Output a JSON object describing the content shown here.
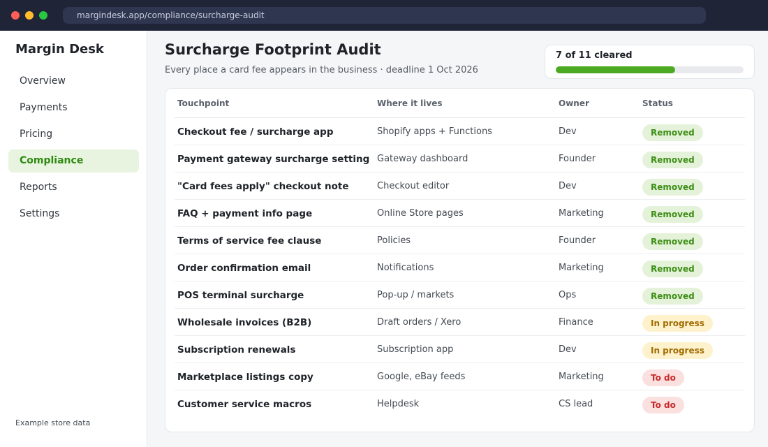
{
  "window": {
    "url": "margindesk.app/compliance/surcharge-audit"
  },
  "sidebar": {
    "brand": "Margin Desk",
    "items": [
      {
        "label": "Overview"
      },
      {
        "label": "Payments"
      },
      {
        "label": "Pricing"
      },
      {
        "label": "Compliance",
        "active": true
      },
      {
        "label": "Reports"
      },
      {
        "label": "Settings"
      }
    ],
    "footnote": "Example store data"
  },
  "header": {
    "title": "Surcharge Footprint Audit",
    "subtitle": "Every place a card fee appears in the business · deadline 1 Oct 2026"
  },
  "progress": {
    "label": "7 of 11 cleared",
    "cleared": 7,
    "total": 11
  },
  "table": {
    "columns": [
      "Touchpoint",
      "Where it lives",
      "Owner",
      "Status"
    ],
    "rows": [
      {
        "touchpoint": "Checkout fee / surcharge app",
        "location": "Shopify apps + Functions",
        "owner": "Dev",
        "status": "Removed",
        "kind": "removed"
      },
      {
        "touchpoint": "Payment gateway surcharge setting",
        "location": "Gateway dashboard",
        "owner": "Founder",
        "status": "Removed",
        "kind": "removed"
      },
      {
        "touchpoint": "\"Card fees apply\" checkout note",
        "location": "Checkout editor",
        "owner": "Dev",
        "status": "Removed",
        "kind": "removed"
      },
      {
        "touchpoint": "FAQ + payment info page",
        "location": "Online Store pages",
        "owner": "Marketing",
        "status": "Removed",
        "kind": "removed"
      },
      {
        "touchpoint": "Terms of service fee clause",
        "location": "Policies",
        "owner": "Founder",
        "status": "Removed",
        "kind": "removed"
      },
      {
        "touchpoint": "Order confirmation email",
        "location": "Notifications",
        "owner": "Marketing",
        "status": "Removed",
        "kind": "removed"
      },
      {
        "touchpoint": "POS terminal surcharge",
        "location": "Pop-up / markets",
        "owner": "Ops",
        "status": "Removed",
        "kind": "removed"
      },
      {
        "touchpoint": "Wholesale invoices (B2B)",
        "location": "Draft orders / Xero",
        "owner": "Finance",
        "status": "In progress",
        "kind": "progress"
      },
      {
        "touchpoint": "Subscription renewals",
        "location": "Subscription app",
        "owner": "Dev",
        "status": "In progress",
        "kind": "progress"
      },
      {
        "touchpoint": "Marketplace listings copy",
        "location": "Google, eBay feeds",
        "owner": "Marketing",
        "status": "To do",
        "kind": "todo"
      },
      {
        "touchpoint": "Customer service macros",
        "location": "Helpdesk",
        "owner": "CS lead",
        "status": "To do",
        "kind": "todo"
      }
    ]
  },
  "colors": {
    "accent": "#4caa22",
    "removed": "#3d8f16",
    "in_progress": "#a26b00",
    "todo": "#c62a2a"
  }
}
